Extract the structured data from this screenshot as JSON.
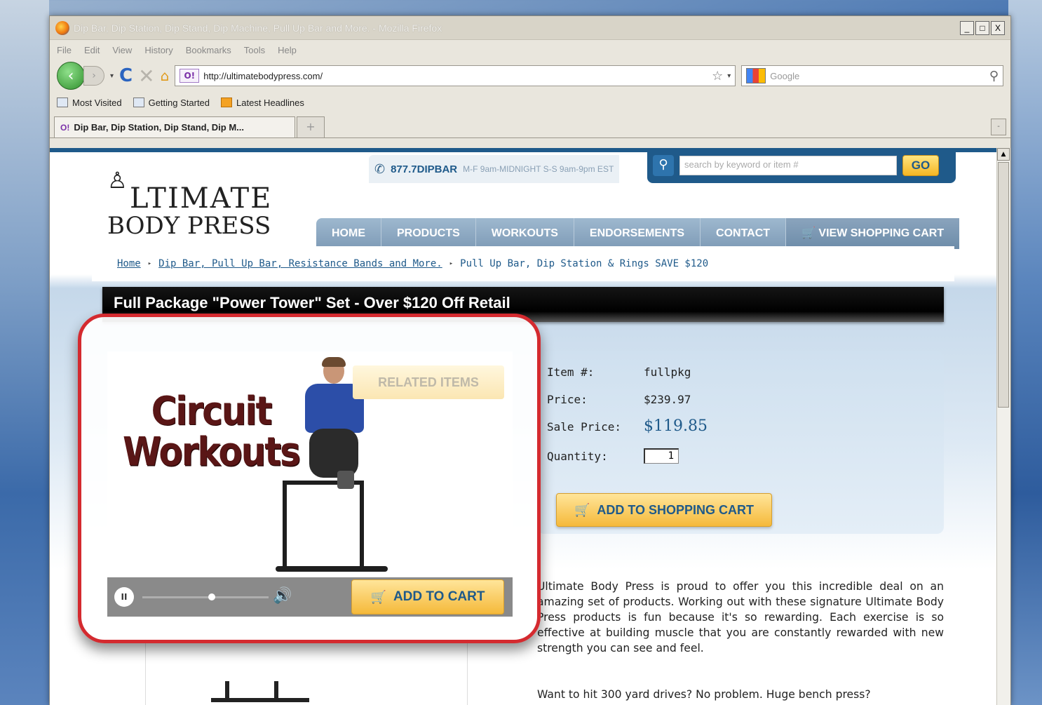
{
  "window": {
    "title": "Dip Bar, Dip Station, Dip Stand, Dip Machine, Pull Up Bar and More. - Mozilla Firefox",
    "minimize": "_",
    "maximize": "□",
    "close": "X"
  },
  "menu": [
    "File",
    "Edit",
    "View",
    "History",
    "Bookmarks",
    "Tools",
    "Help"
  ],
  "nav": {
    "url": "http://ultimatebodypress.com/",
    "search_placeholder": "Google"
  },
  "bookmarks": [
    "Most Visited",
    "Getting Started",
    "Latest Headlines"
  ],
  "tab": {
    "label": "Dip Bar, Dip Station, Dip Stand, Dip M...",
    "new_tab": "+",
    "list": "-"
  },
  "site": {
    "logo_line1": "LTIMATE",
    "logo_line2": "BODY PRESS",
    "phone": "877.7DIPBAR",
    "hours": "M-F 9am-MIDNIGHT S-S 9am-9pm EST",
    "search_placeholder": "search by keyword or item #",
    "go": "GO",
    "nav": [
      "HOME",
      "PRODUCTS",
      "WORKOUTS",
      "ENDORSEMENTS",
      "CONTACT",
      "VIEW SHOPPING CART"
    ]
  },
  "breadcrumb": {
    "home": "Home",
    "category": "Dip Bar, Pull Up Bar, Resistance Bands and More.",
    "current": "Pull Up Bar, Dip Station & Rings SAVE $120"
  },
  "product": {
    "title": "Full Package \"Power Tower\" Set - Over $120 Off Retail",
    "item_label": "Item #:",
    "item_value": "fullpkg",
    "price_label": "Price:",
    "price_value": "$239.97",
    "sale_label": "Sale Price:",
    "sale_value": "$119.85",
    "qty_label": "Quantity:",
    "qty_value": "1",
    "add_to_cart": "ADD TO SHOPPING CART",
    "description": "Ultimate Body Press is proud to offer you this incredible deal on an amazing set of products. Working out with these signature Ultimate Body Press products is fun because it's so rewarding. Each exercise is so effective at building muscle that you are constantly rewarded with new strength you can see and feel.",
    "description2": "Want to hit 300 yard drives? No problem. Huge bench press?"
  },
  "video": {
    "circuit_line1": "Circuit",
    "circuit_line2": "Workouts",
    "related": "RELATED ITEMS",
    "add_to_cart": "ADD TO CART",
    "progress": 0.55
  }
}
